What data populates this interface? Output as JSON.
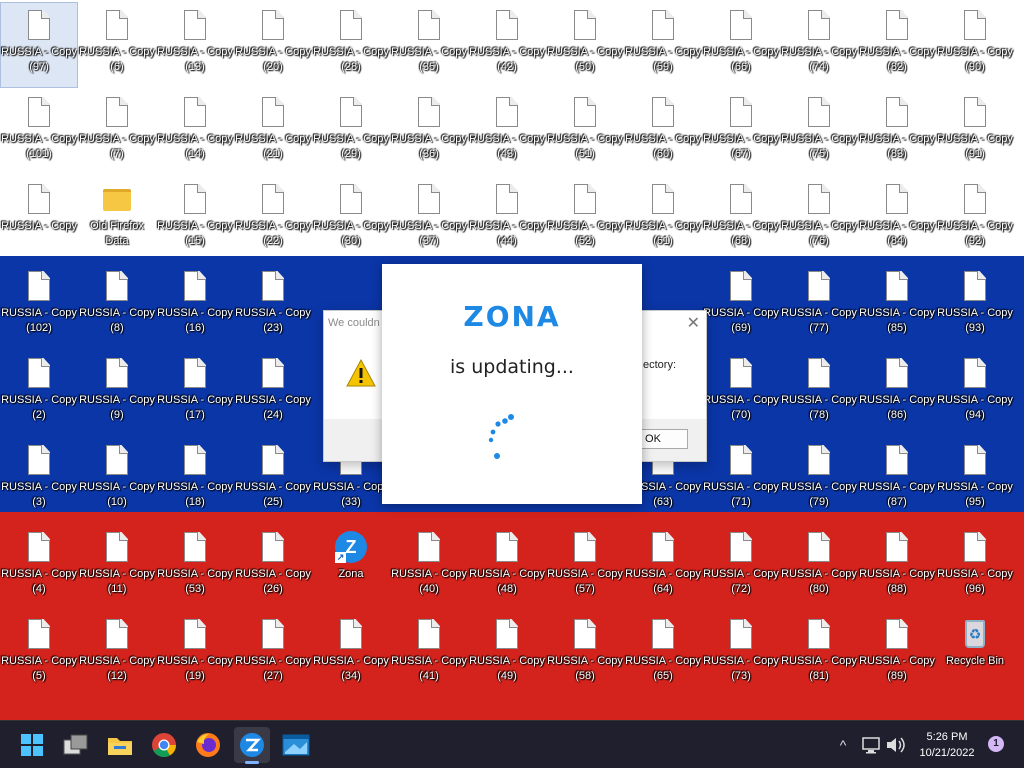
{
  "desktop": {
    "wallpaper_colors": {
      "white": "#ffffff",
      "blue": "#0b36a8",
      "red": "#d4231c"
    },
    "rows": [
      [
        "RUSSIA - Copy (97)",
        "RUSSIA - Copy (6)",
        "RUSSIA - Copy (13)",
        "RUSSIA - Copy (20)",
        "RUSSIA - Copy (28)",
        "RUSSIA - Copy (35)",
        "RUSSIA - Copy (42)",
        "RUSSIA - Copy (50)",
        "RUSSIA - Copy (59)",
        "RUSSIA - Copy (66)",
        "RUSSIA - Copy (74)",
        "RUSSIA - Copy (82)",
        "RUSSIA - Copy (90)"
      ],
      [
        "RUSSIA - Copy (101)",
        "RUSSIA - Copy (7)",
        "RUSSIA - Copy (14)",
        "RUSSIA - Copy (21)",
        "RUSSIA - Copy (29)",
        "RUSSIA - Copy (36)",
        "RUSSIA - Copy (43)",
        "RUSSIA - Copy (51)",
        "RUSSIA - Copy (60)",
        "RUSSIA - Copy (67)",
        "RUSSIA - Copy (75)",
        "RUSSIA - Copy (83)",
        "RUSSIA - Copy (91)"
      ],
      [
        "RUSSIA - Copy",
        "Old Firefox Data",
        "RUSSIA - Copy (15)",
        "RUSSIA - Copy (22)",
        "RUSSIA - Copy (30)",
        "RUSSIA - Copy (37)",
        "RUSSIA - Copy (44)",
        "RUSSIA - Copy (52)",
        "RUSSIA - Copy (61)",
        "RUSSIA - Copy (68)",
        "RUSSIA - Copy (76)",
        "RUSSIA - Copy (84)",
        "RUSSIA - Copy (92)"
      ],
      [
        "RUSSIA - Copy (102)",
        "RUSSIA - Copy (8)",
        "RUSSIA - Copy (16)",
        "RUSSIA - Copy (23)",
        "",
        "",
        "",
        "",
        "",
        "RUSSIA - Copy (69)",
        "RUSSIA - Copy (77)",
        "RUSSIA - Copy (85)",
        "RUSSIA - Copy (93)"
      ],
      [
        "RUSSIA - Copy (2)",
        "RUSSIA - Copy (9)",
        "RUSSIA - Copy (17)",
        "RUSSIA - Copy (24)",
        "",
        "",
        "",
        "",
        "",
        "RUSSIA - Copy (70)",
        "RUSSIA - Copy (78)",
        "RUSSIA - Copy (86)",
        "RUSSIA - Copy (94)"
      ],
      [
        "RUSSIA - Copy (3)",
        "RUSSIA - Copy (10)",
        "RUSSIA - Copy (18)",
        "RUSSIA - Copy (25)",
        "RUSSIA - Copy (33)",
        "",
        "",
        "",
        "RUSSIA - Copy (63)",
        "RUSSIA - Copy (71)",
        "RUSSIA - Copy (79)",
        "RUSSIA - Copy (87)",
        "RUSSIA - Copy (95)"
      ],
      [
        "RUSSIA - Copy (4)",
        "RUSSIA - Copy (11)",
        "RUSSIA - Copy (53)",
        "RUSSIA - Copy (26)",
        "Zona",
        "RUSSIA - Copy (40)",
        "RUSSIA - Copy (48)",
        "RUSSIA - Copy (57)",
        "RUSSIA - Copy (64)",
        "RUSSIA - Copy (72)",
        "RUSSIA - Copy (80)",
        "RUSSIA - Copy (88)",
        "RUSSIA - Copy (96)"
      ],
      [
        "RUSSIA - Copy (5)",
        "RUSSIA - Copy (12)",
        "RUSSIA - Copy (19)",
        "RUSSIA - Copy (27)",
        "RUSSIA - Copy (34)",
        "RUSSIA - Copy (41)",
        "RUSSIA - Copy (49)",
        "RUSSIA - Copy (58)",
        "RUSSIA - Copy (65)",
        "RUSSIA - Copy (73)",
        "RUSSIA - Copy (81)",
        "RUSSIA - Copy (89)",
        "Recycle Bin"
      ]
    ],
    "special_icons": {
      "Old Firefox Data": "folder-icon",
      "Zona": "zona-shortcut-icon",
      "Recycle Bin": "recycle-bin-icon"
    },
    "selected_icon": "RUSSIA - Copy (97)"
  },
  "error_dialog": {
    "title": "We couldn",
    "message": "ectory:",
    "ok_label": "OK",
    "close_glyph": "✕"
  },
  "zona_splash": {
    "logo": "ZONA",
    "status": "is updating...",
    "brand_color": "#1e88e5"
  },
  "taskbar": {
    "apps": [
      {
        "name": "start-button",
        "icon": "windows-logo-icon",
        "active": false
      },
      {
        "name": "task-view",
        "icon": "task-view-icon",
        "active": false
      },
      {
        "name": "file-explorer",
        "icon": "folder-icon",
        "active": false
      },
      {
        "name": "chrome",
        "icon": "chrome-icon",
        "active": false
      },
      {
        "name": "firefox",
        "icon": "firefox-icon",
        "active": false
      },
      {
        "name": "zona",
        "icon": "zona-icon",
        "active": true
      },
      {
        "name": "remote-desktop",
        "icon": "window-icon",
        "active": false
      }
    ],
    "tray_chevron": "^",
    "time": "5:26 PM",
    "date": "10/21/2022",
    "notification_count": "1"
  }
}
